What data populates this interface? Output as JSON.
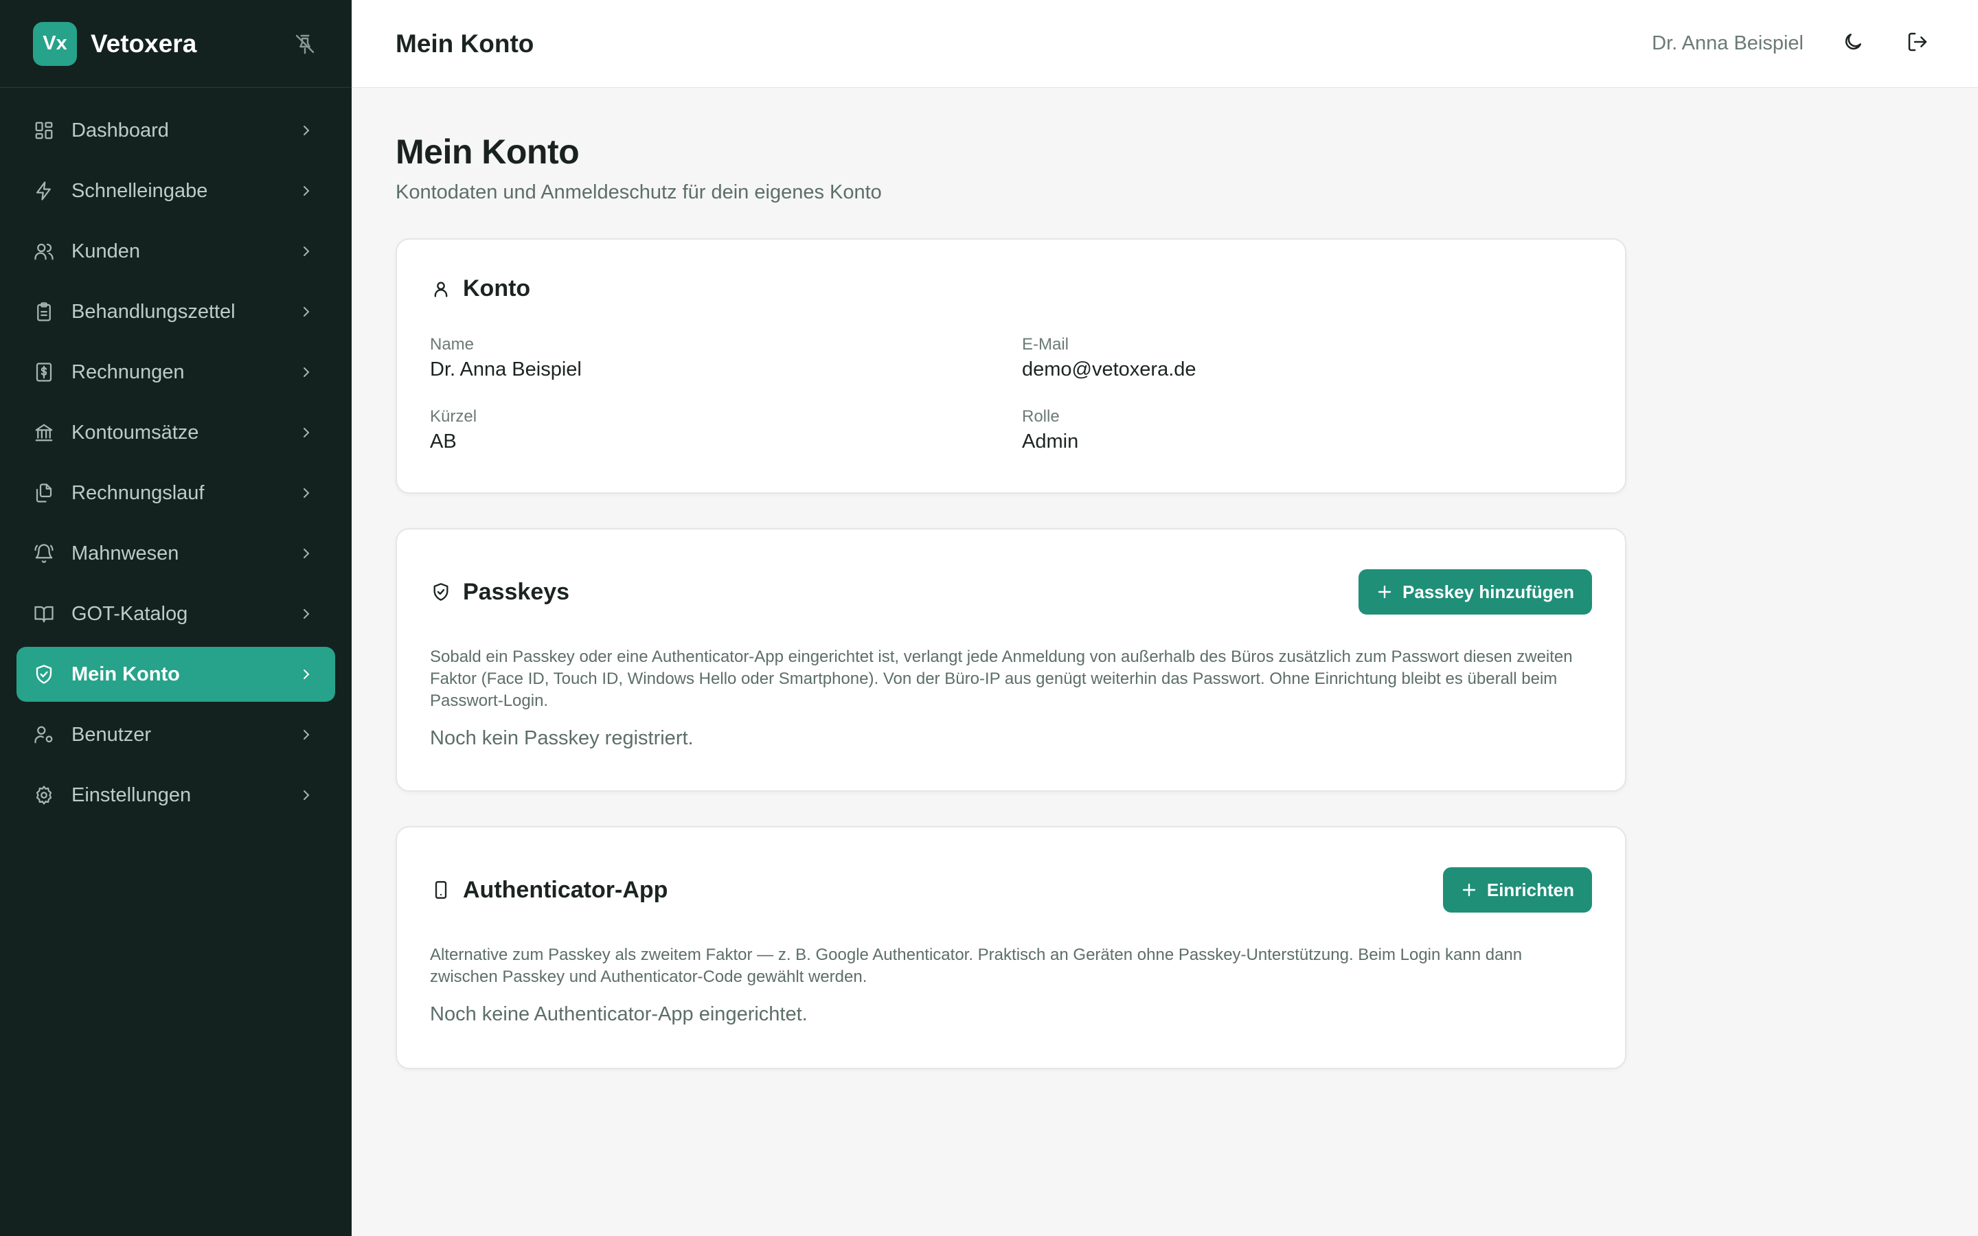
{
  "sidebar": {
    "logo": "Vx",
    "brand": "Vetoxera",
    "items": [
      {
        "label": "Dashboard",
        "icon": "dashboard-icon",
        "active": false
      },
      {
        "label": "Schnelleingabe",
        "icon": "lightning-icon",
        "active": false
      },
      {
        "label": "Kunden",
        "icon": "users-icon",
        "active": false
      },
      {
        "label": "Behandlungszettel",
        "icon": "clipboard-icon",
        "active": false
      },
      {
        "label": "Rechnungen",
        "icon": "invoice-icon",
        "active": false
      },
      {
        "label": "Kontoumsätze",
        "icon": "bank-icon",
        "active": false
      },
      {
        "label": "Rechnungslauf",
        "icon": "files-icon",
        "active": false
      },
      {
        "label": "Mahnwesen",
        "icon": "bell-icon",
        "active": false
      },
      {
        "label": "GOT-Katalog",
        "icon": "book-icon",
        "active": false
      },
      {
        "label": "Mein Konto",
        "icon": "shield-check-icon",
        "active": true
      },
      {
        "label": "Benutzer",
        "icon": "user-cog-icon",
        "active": false
      },
      {
        "label": "Einstellungen",
        "icon": "gear-icon",
        "active": false
      }
    ]
  },
  "topbar": {
    "title": "Mein Konto",
    "user": "Dr. Anna Beispiel"
  },
  "page": {
    "title": "Mein Konto",
    "subtitle": "Kontodaten und Anmeldeschutz für dein eigenes Konto"
  },
  "account": {
    "title": "Konto",
    "name_label": "Name",
    "name_value": "Dr. Anna Beispiel",
    "email_label": "E-Mail",
    "email_value": "demo@vetoxera.de",
    "short_label": "Kürzel",
    "short_value": "AB",
    "role_label": "Rolle",
    "role_value": "Admin"
  },
  "passkeys": {
    "title": "Passkeys",
    "button": "Passkey hinzufügen",
    "description": "Sobald ein Passkey oder eine Authenticator-App eingerichtet ist, verlangt jede Anmeldung von außerhalb des Büros zusätzlich zum Passwort diesen zweiten Faktor (Face ID, Touch ID, Windows Hello oder Smartphone). Von der Büro-IP aus genügt weiterhin das Passwort. Ohne Einrichtung bleibt es überall beim Passwort-Login.",
    "empty": "Noch kein Passkey registriert."
  },
  "authenticator": {
    "title": "Authenticator-App",
    "button": "Einrichten",
    "description": "Alternative zum Passkey als zweitem Faktor — z. B. Google Authenticator. Praktisch an Geräten ohne Passkey-Unterstützung. Beim Login kann dann zwischen Passkey und Authenticator-Code gewählt werden.",
    "empty": "Noch keine Authenticator-App eingerichtet."
  },
  "colors": {
    "sidebar_bg": "#14221f",
    "accent": "#26a38a",
    "button": "#1f8f78"
  }
}
